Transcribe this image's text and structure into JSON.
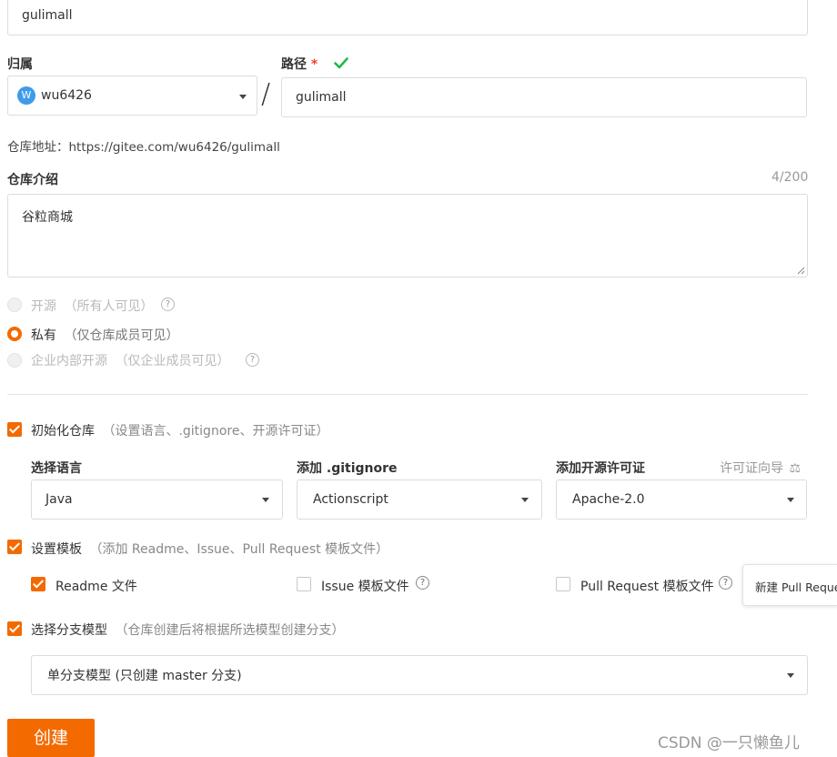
{
  "repo_name": {
    "value": "gulimall"
  },
  "owner": {
    "label": "归属",
    "avatar_letter": "W",
    "value": "wu6426"
  },
  "separator": "/",
  "path": {
    "label": "路径",
    "required_mark": "*",
    "value": "gulimall"
  },
  "repo_address": "仓库地址：https://gitee.com/wu6426/gulimall",
  "description": {
    "label": "仓库介绍",
    "counter": "4/200",
    "value": "谷粒商城"
  },
  "visibility": {
    "options": [
      {
        "label": "开源",
        "hint": "（所有人可见）",
        "state": "disabled"
      },
      {
        "label": "私有",
        "hint": "（仅仓库成员可见）",
        "state": "checked"
      },
      {
        "label": "企业内部开源",
        "hint": "（仅企业成员可见）",
        "state": "disabled"
      }
    ]
  },
  "init_repo": {
    "label": "初始化仓库",
    "hint": "（设置语言、.gitignore、开源许可证）",
    "checked": true,
    "language": {
      "label": "选择语言",
      "value": "Java"
    },
    "gitignore": {
      "label": "添加 .gitignore",
      "value": "Actionscript"
    },
    "license": {
      "label": "添加开源许可证",
      "guide": "许可证向导",
      "value": "Apache-2.0"
    }
  },
  "templates": {
    "label": "设置模板",
    "hint": "（添加 Readme、Issue、Pull Request 模板文件）",
    "checked": true,
    "readme": {
      "label": "Readme 文件",
      "checked": true
    },
    "issue": {
      "label": "Issue 模板文件",
      "checked": false
    },
    "pull_request": {
      "label": "Pull Request 模板文件",
      "checked": false
    },
    "tooltip": "新建 Pull Reque"
  },
  "branch_model": {
    "label": "选择分支模型",
    "hint": "（仓库创建后将根据所选模型创建分支）",
    "checked": true,
    "value": "单分支模型 (只创建 master 分支)"
  },
  "create_button": "创建",
  "watermark": "CSDN @一只懒鱼儿",
  "colors": {
    "accent": "#f36a00",
    "success": "#21ba45",
    "avatar": "#3e9be8"
  }
}
